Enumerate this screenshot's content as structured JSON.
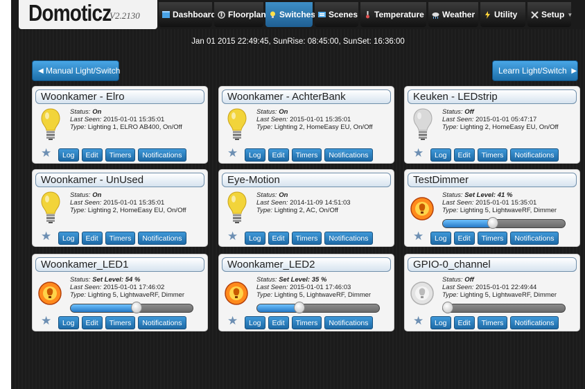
{
  "app": {
    "logo": "Domoticz",
    "version": "V2.2130"
  },
  "nav": [
    {
      "label": "Dashboard",
      "icon": "dashboard-icon",
      "active": false
    },
    {
      "label": "Floorplan",
      "icon": "floorplan-icon",
      "active": false
    },
    {
      "label": "Switches",
      "icon": "bulb-icon",
      "active": true
    },
    {
      "label": "Scenes",
      "icon": "scenes-icon",
      "active": false
    },
    {
      "label": "Temperature",
      "icon": "thermometer-icon",
      "active": false
    },
    {
      "label": "Weather",
      "icon": "weather-icon",
      "active": false
    },
    {
      "label": "Utility",
      "icon": "utility-icon",
      "active": false
    },
    {
      "label": "Setup",
      "icon": "tools-icon",
      "active": false
    }
  ],
  "sunline": "Jan 01 2015 22:49:45, SunRise: 08:45:00, SunSet: 16:36:00",
  "buttons": {
    "manual": "Manual Light/Switch",
    "learn": "Learn Light/Switch"
  },
  "labels": {
    "status": "Status:",
    "last_seen": "Last Seen:",
    "type": "Type:",
    "log": "Log",
    "edit": "Edit",
    "timers": "Timers",
    "notifications": "Notifications"
  },
  "colors": {
    "accent": "#2a80c2",
    "card_bg": "#f4f4f4",
    "bulb_on": "#f2d43a",
    "bulb_off": "#d9d9d9"
  },
  "devices": [
    {
      "name": "Woonkamer - Elro",
      "status": "On",
      "last_seen": "2015-01-01 15:35:01",
      "type": "Lighting 1, ELRO AB400, On/Off",
      "kind": "switch",
      "on": true
    },
    {
      "name": "Woonkamer - AchterBank",
      "status": "On",
      "last_seen": "2015-01-01 15:35:01",
      "type": "Lighting 2, HomeEasy EU, On/Off",
      "kind": "switch",
      "on": true
    },
    {
      "name": "Keuken - LEDstrip",
      "status": "Off",
      "last_seen": "2015-01-01 05:47:17",
      "type": "Lighting 2, HomeEasy EU, On/Off",
      "kind": "switch",
      "on": false
    },
    {
      "name": "Woonkamer - UnUsed",
      "status": "On",
      "last_seen": "2015-01-01 15:35:01",
      "type": "Lighting 2, HomeEasy EU, On/Off",
      "kind": "switch",
      "on": true
    },
    {
      "name": "Eye-Motion",
      "status": "On",
      "last_seen": "2014-11-09 14:51:03",
      "type": "Lighting 2, AC, On/Off",
      "kind": "switch",
      "on": true
    },
    {
      "name": "TestDimmer",
      "status": "Set Level: 41 %",
      "last_seen": "2015-01-01 15:35:01",
      "type": "Lighting 5, LightwaveRF, Dimmer",
      "kind": "dimmer",
      "on": true,
      "level": 41
    },
    {
      "name": "Woonkamer_LED1",
      "status": "Set Level: 54 %",
      "last_seen": "2015-01-01 17:46:02",
      "type": "Lighting 5, LightwaveRF, Dimmer",
      "kind": "dimmer",
      "on": true,
      "level": 54
    },
    {
      "name": "Woonkamer_LED2",
      "status": "Set Level: 35 %",
      "last_seen": "2015-01-01 17:46:03",
      "type": "Lighting 5, LightwaveRF, Dimmer",
      "kind": "dimmer",
      "on": true,
      "level": 35
    },
    {
      "name": "GPIO-0_channel",
      "status": "Off",
      "last_seen": "2015-01-01 22:49:44",
      "type": "Lighting 5, LightwaveRF, Dimmer",
      "kind": "dimmer",
      "on": false,
      "level": 0
    }
  ]
}
